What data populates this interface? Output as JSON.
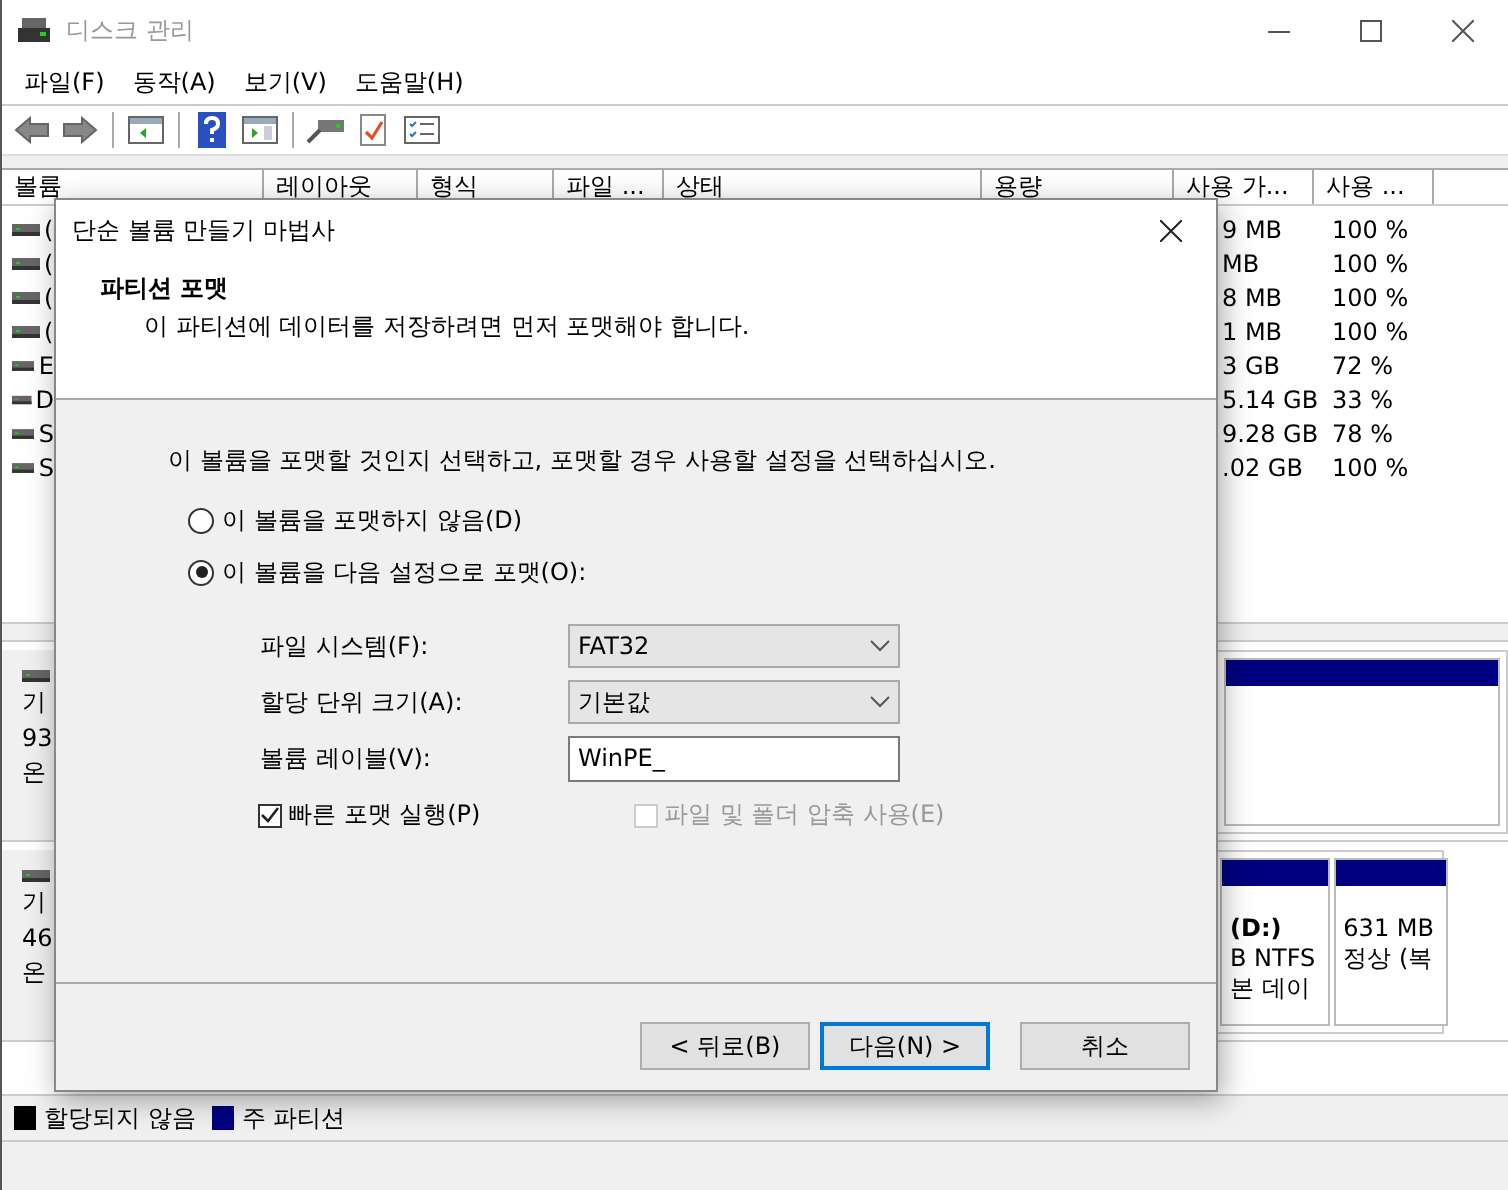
{
  "window": {
    "title": "디스크 관리"
  },
  "menu": [
    {
      "label": "파일(F)"
    },
    {
      "label": "동작(A)"
    },
    {
      "label": "보기(V)"
    },
    {
      "label": "도움말(H)"
    }
  ],
  "volume_table": {
    "columns": [
      "볼륨",
      "레이아웃",
      "형식",
      "파일 ...",
      "상태",
      "용량",
      "사용 가...",
      "사용 ..."
    ],
    "rows": [
      {
        "volume": "(",
        "free_space": "9 MB",
        "free_percent": "100 %"
      },
      {
        "volume": "(",
        "free_space": "MB",
        "free_percent": "100 %"
      },
      {
        "volume": "(",
        "free_space": "8 MB",
        "free_percent": "100 %"
      },
      {
        "volume": "(",
        "free_space": "1 MB",
        "free_percent": "100 %"
      },
      {
        "volume": "E",
        "free_space": "3 GB",
        "free_percent": "72 %"
      },
      {
        "volume": "D",
        "free_space": "5.14 GB",
        "free_percent": "33 %"
      },
      {
        "volume": "S",
        "free_space": "9.28 GB",
        "free_percent": "78 %"
      },
      {
        "volume": "S",
        "free_space": ".02 GB",
        "free_percent": "100 %"
      }
    ]
  },
  "disks": [
    {
      "label_lines": [
        "기",
        "93",
        "온"
      ],
      "partitions": [
        {
          "kind": "primary"
        }
      ]
    },
    {
      "label_lines": [
        "기",
        "46",
        "온"
      ],
      "partitions": [
        {
          "kind": "primary",
          "lines": [
            "(D:)",
            "B NTFS",
            "본 데이"
          ]
        },
        {
          "kind": "primary",
          "lines": [
            "631 MB",
            "정상 (복"
          ]
        }
      ]
    }
  ],
  "legend": [
    {
      "label": "할당되지 않음",
      "color": "#000000"
    },
    {
      "label": "주 파티션",
      "color": "#000080"
    }
  ],
  "dialog": {
    "title": "단순 볼륨 만들기 마법사",
    "heading": "파티션 포맷",
    "subheading": "이 파티션에 데이터를 저장하려면 먼저 포맷해야 합니다.",
    "instruction": "이 볼륨을 포맷할 것인지 선택하고, 포맷할 경우 사용할 설정을 선택하십시오.",
    "format_options": [
      {
        "label": "이 볼륨을 포맷하지 않음(D)",
        "selected": false
      },
      {
        "label": "이 볼륨을 다음 설정으로 포맷(O):",
        "selected": true
      }
    ],
    "fields": [
      {
        "kind": "dropdown",
        "label": "파일 시스템(F):",
        "value": "FAT32"
      },
      {
        "kind": "dropdown",
        "label": "할당 단위 크기(A):",
        "value": "기본값"
      },
      {
        "kind": "text",
        "label": "볼륨 레이블(V):",
        "value": "WinPE_"
      }
    ],
    "checkboxes": [
      {
        "label": "빠른 포맷 실행(P)",
        "checked": true,
        "disabled": false
      },
      {
        "label": "파일 및 폴더 압축 사용(E)",
        "checked": false,
        "disabled": true
      }
    ],
    "buttons": [
      {
        "label": "< 뒤로(B)",
        "focused": false
      },
      {
        "label": "다음(N) >",
        "focused": true
      },
      {
        "label": "취소",
        "focused": false
      }
    ]
  }
}
